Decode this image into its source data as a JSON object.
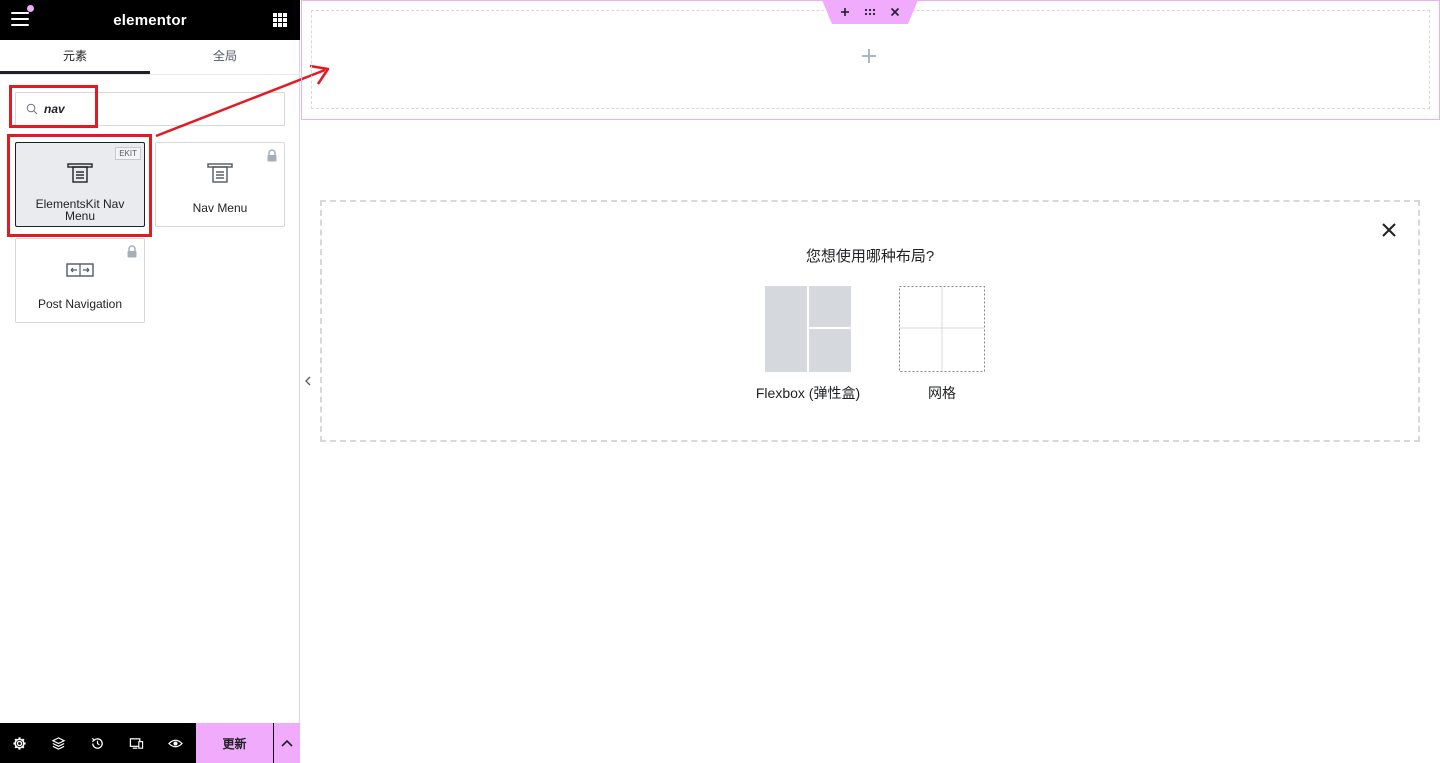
{
  "topbar": {
    "logo": "elementor"
  },
  "tabs": [
    {
      "label": "元素",
      "active": true
    },
    {
      "label": "全局",
      "active": false
    }
  ],
  "search": {
    "value": "nav"
  },
  "widgets": [
    {
      "label": "ElementsKit Nav Menu",
      "badge": "EKIT",
      "icon": "nav-menu-icon",
      "selected": true
    },
    {
      "label": "Nav Menu",
      "icon": "nav-menu-icon",
      "locked": true
    },
    {
      "label": "Post Navigation",
      "icon": "post-navigation-icon",
      "locked": true
    }
  ],
  "bottombar": {
    "icons": [
      "settings-icon",
      "layers-icon",
      "history-icon",
      "responsive-icon",
      "preview-icon"
    ],
    "update_label": "更新"
  },
  "canvas": {
    "layout_prompt": "您想使用哪种布局?",
    "options": [
      {
        "label": "Flexbox (弹性盒)"
      },
      {
        "label": "网格"
      }
    ]
  },
  "colors": {
    "accent": "#f0abfc",
    "annotation": "#e11b22",
    "dark": "#000000"
  }
}
